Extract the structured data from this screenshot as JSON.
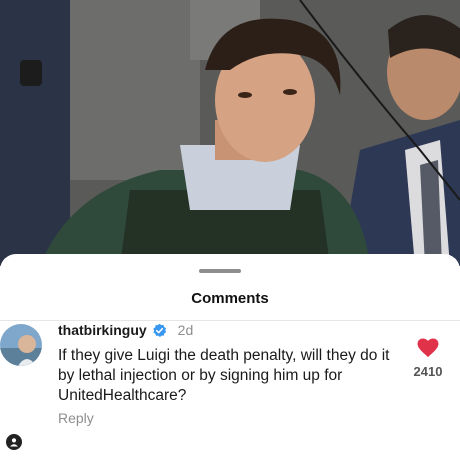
{
  "sheet": {
    "title": "Comments"
  },
  "comment": {
    "username": "thatbirkinguy",
    "verified": true,
    "age": "2d",
    "text": "If they give Luigi the death penalty, will they do it by lethal injection or by signing him up for UnitedHealthcare?",
    "reply_label": "Reply",
    "like_count": "2410",
    "like_color": "#e0334a"
  },
  "icons": {
    "verified": "verified-badge-icon",
    "like": "heart-icon",
    "profile": "profile-icon"
  },
  "colors": {
    "verified_blue": "#3897f0",
    "muted_text": "#8e8e8e"
  }
}
